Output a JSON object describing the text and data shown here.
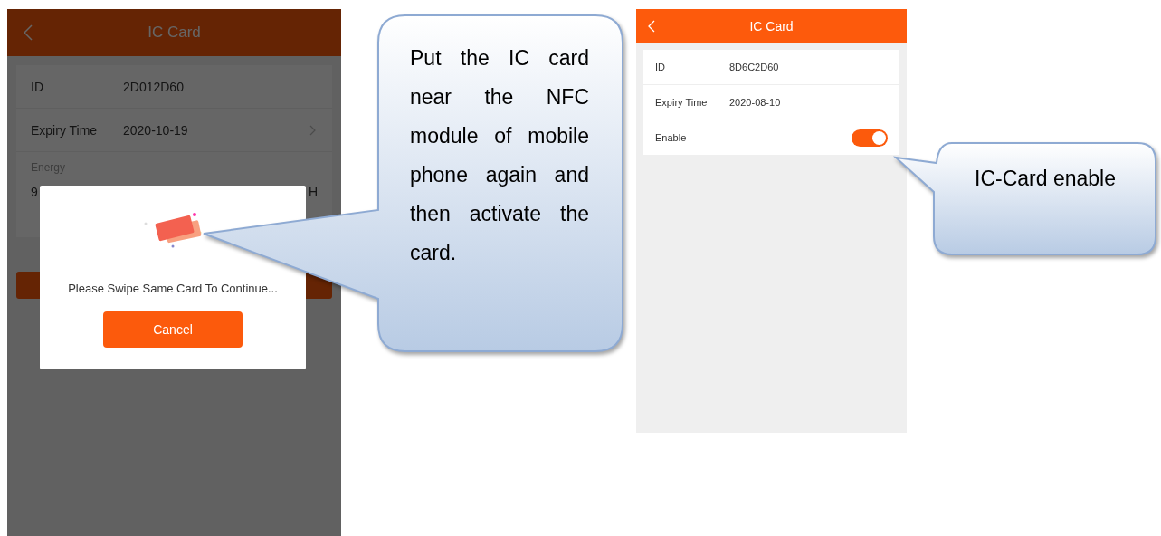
{
  "left_screen": {
    "title": "IC Card",
    "rows": [
      {
        "label": "ID",
        "value": "2D012D60",
        "chevron": false
      },
      {
        "label": "Expiry Time",
        "value": "2020-10-19",
        "chevron": true
      }
    ],
    "energy": {
      "label": "Energy",
      "value": "9",
      "unit": "H"
    },
    "dialog": {
      "message": "Please Swipe Same Card To Continue...",
      "button": "Cancel"
    }
  },
  "right_screen": {
    "title": "IC Card",
    "rows": [
      {
        "kind": "text",
        "label": "ID",
        "value": "8D6C2D60"
      },
      {
        "kind": "text",
        "label": "Expiry Time",
        "value": "2020-08-10"
      },
      {
        "kind": "toggle",
        "label": "Enable",
        "on": true
      }
    ]
  },
  "callouts": [
    {
      "text": "Put the IC card near the NFC module of mobile phone again and then activate the card."
    },
    {
      "text": "IC-Card enable"
    }
  ]
}
